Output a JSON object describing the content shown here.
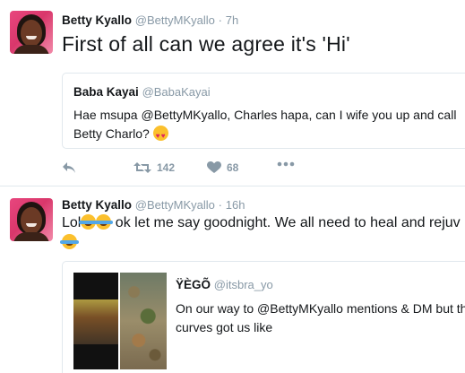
{
  "tweets": [
    {
      "name": "Betty Kyallo",
      "handle": "@BettyMKyallo",
      "separator": "·",
      "time": "7h",
      "text": "First of all can we agree it's 'Hi'",
      "quote": {
        "name": "Baba Kayai",
        "handle": "@BabaKayai",
        "line1": "Hae msupa @BettyMKyallo, Charles hapa, can I wife you up and call",
        "line2": "Betty Charlo?",
        "emoji": "heart-eyes-emoji"
      },
      "actions": {
        "reply_icon": "reply-icon",
        "retweet_icon": "retweet-icon",
        "retweet_count": "142",
        "like_icon": "heart-icon",
        "like_count": "68",
        "more_icon": "more-icon"
      }
    },
    {
      "name": "Betty Kyallo",
      "handle": "@BettyMKyallo",
      "separator": "·",
      "time": "16h",
      "text_prefix": "Lol",
      "text_main": " ok let me say goodnight. We all need to heal and rejuv",
      "emoji": "joy-emoji",
      "quote": {
        "name": "ŸÈGÕ",
        "handle": "@itsbra_yo",
        "line1": "On our way to @BettyMKyallo mentions & DM but th",
        "line2": "curves got us like"
      }
    }
  ],
  "colors": {
    "text": "#14171a",
    "muted": "#8899a6",
    "border": "#e1e8ed",
    "avatar_bg": "#e8467e"
  }
}
